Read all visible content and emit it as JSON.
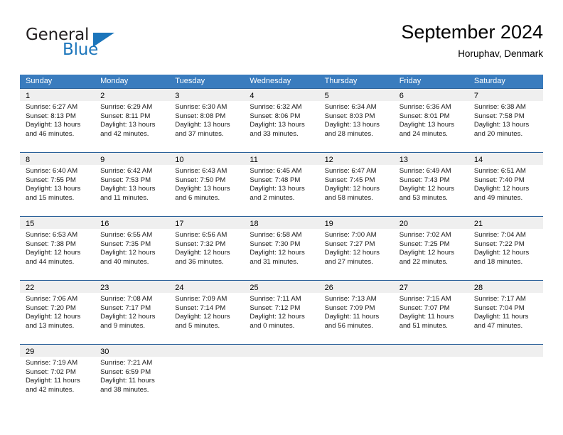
{
  "brand": {
    "name_part1": "General",
    "name_part2": "Blue",
    "logo_icon": "triangle-logo-icon"
  },
  "header": {
    "title": "September 2024",
    "location": "Horuphav, Denmark"
  },
  "colors": {
    "header_blue": "#3a7cbe",
    "rule_blue": "#2a6099",
    "band_gray": "#efefef",
    "brand_blue": "#1b75bb"
  },
  "weekdays": [
    "Sunday",
    "Monday",
    "Tuesday",
    "Wednesday",
    "Thursday",
    "Friday",
    "Saturday"
  ],
  "weeks": [
    [
      {
        "day": "1",
        "sunrise": "Sunrise: 6:27 AM",
        "sunset": "Sunset: 8:13 PM",
        "daylight1": "Daylight: 13 hours",
        "daylight2": "and 46 minutes."
      },
      {
        "day": "2",
        "sunrise": "Sunrise: 6:29 AM",
        "sunset": "Sunset: 8:11 PM",
        "daylight1": "Daylight: 13 hours",
        "daylight2": "and 42 minutes."
      },
      {
        "day": "3",
        "sunrise": "Sunrise: 6:30 AM",
        "sunset": "Sunset: 8:08 PM",
        "daylight1": "Daylight: 13 hours",
        "daylight2": "and 37 minutes."
      },
      {
        "day": "4",
        "sunrise": "Sunrise: 6:32 AM",
        "sunset": "Sunset: 8:06 PM",
        "daylight1": "Daylight: 13 hours",
        "daylight2": "and 33 minutes."
      },
      {
        "day": "5",
        "sunrise": "Sunrise: 6:34 AM",
        "sunset": "Sunset: 8:03 PM",
        "daylight1": "Daylight: 13 hours",
        "daylight2": "and 28 minutes."
      },
      {
        "day": "6",
        "sunrise": "Sunrise: 6:36 AM",
        "sunset": "Sunset: 8:01 PM",
        "daylight1": "Daylight: 13 hours",
        "daylight2": "and 24 minutes."
      },
      {
        "day": "7",
        "sunrise": "Sunrise: 6:38 AM",
        "sunset": "Sunset: 7:58 PM",
        "daylight1": "Daylight: 13 hours",
        "daylight2": "and 20 minutes."
      }
    ],
    [
      {
        "day": "8",
        "sunrise": "Sunrise: 6:40 AM",
        "sunset": "Sunset: 7:55 PM",
        "daylight1": "Daylight: 13 hours",
        "daylight2": "and 15 minutes."
      },
      {
        "day": "9",
        "sunrise": "Sunrise: 6:42 AM",
        "sunset": "Sunset: 7:53 PM",
        "daylight1": "Daylight: 13 hours",
        "daylight2": "and 11 minutes."
      },
      {
        "day": "10",
        "sunrise": "Sunrise: 6:43 AM",
        "sunset": "Sunset: 7:50 PM",
        "daylight1": "Daylight: 13 hours",
        "daylight2": "and 6 minutes."
      },
      {
        "day": "11",
        "sunrise": "Sunrise: 6:45 AM",
        "sunset": "Sunset: 7:48 PM",
        "daylight1": "Daylight: 13 hours",
        "daylight2": "and 2 minutes."
      },
      {
        "day": "12",
        "sunrise": "Sunrise: 6:47 AM",
        "sunset": "Sunset: 7:45 PM",
        "daylight1": "Daylight: 12 hours",
        "daylight2": "and 58 minutes."
      },
      {
        "day": "13",
        "sunrise": "Sunrise: 6:49 AM",
        "sunset": "Sunset: 7:43 PM",
        "daylight1": "Daylight: 12 hours",
        "daylight2": "and 53 minutes."
      },
      {
        "day": "14",
        "sunrise": "Sunrise: 6:51 AM",
        "sunset": "Sunset: 7:40 PM",
        "daylight1": "Daylight: 12 hours",
        "daylight2": "and 49 minutes."
      }
    ],
    [
      {
        "day": "15",
        "sunrise": "Sunrise: 6:53 AM",
        "sunset": "Sunset: 7:38 PM",
        "daylight1": "Daylight: 12 hours",
        "daylight2": "and 44 minutes."
      },
      {
        "day": "16",
        "sunrise": "Sunrise: 6:55 AM",
        "sunset": "Sunset: 7:35 PM",
        "daylight1": "Daylight: 12 hours",
        "daylight2": "and 40 minutes."
      },
      {
        "day": "17",
        "sunrise": "Sunrise: 6:56 AM",
        "sunset": "Sunset: 7:32 PM",
        "daylight1": "Daylight: 12 hours",
        "daylight2": "and 36 minutes."
      },
      {
        "day": "18",
        "sunrise": "Sunrise: 6:58 AM",
        "sunset": "Sunset: 7:30 PM",
        "daylight1": "Daylight: 12 hours",
        "daylight2": "and 31 minutes."
      },
      {
        "day": "19",
        "sunrise": "Sunrise: 7:00 AM",
        "sunset": "Sunset: 7:27 PM",
        "daylight1": "Daylight: 12 hours",
        "daylight2": "and 27 minutes."
      },
      {
        "day": "20",
        "sunrise": "Sunrise: 7:02 AM",
        "sunset": "Sunset: 7:25 PM",
        "daylight1": "Daylight: 12 hours",
        "daylight2": "and 22 minutes."
      },
      {
        "day": "21",
        "sunrise": "Sunrise: 7:04 AM",
        "sunset": "Sunset: 7:22 PM",
        "daylight1": "Daylight: 12 hours",
        "daylight2": "and 18 minutes."
      }
    ],
    [
      {
        "day": "22",
        "sunrise": "Sunrise: 7:06 AM",
        "sunset": "Sunset: 7:20 PM",
        "daylight1": "Daylight: 12 hours",
        "daylight2": "and 13 minutes."
      },
      {
        "day": "23",
        "sunrise": "Sunrise: 7:08 AM",
        "sunset": "Sunset: 7:17 PM",
        "daylight1": "Daylight: 12 hours",
        "daylight2": "and 9 minutes."
      },
      {
        "day": "24",
        "sunrise": "Sunrise: 7:09 AM",
        "sunset": "Sunset: 7:14 PM",
        "daylight1": "Daylight: 12 hours",
        "daylight2": "and 5 minutes."
      },
      {
        "day": "25",
        "sunrise": "Sunrise: 7:11 AM",
        "sunset": "Sunset: 7:12 PM",
        "daylight1": "Daylight: 12 hours",
        "daylight2": "and 0 minutes."
      },
      {
        "day": "26",
        "sunrise": "Sunrise: 7:13 AM",
        "sunset": "Sunset: 7:09 PM",
        "daylight1": "Daylight: 11 hours",
        "daylight2": "and 56 minutes."
      },
      {
        "day": "27",
        "sunrise": "Sunrise: 7:15 AM",
        "sunset": "Sunset: 7:07 PM",
        "daylight1": "Daylight: 11 hours",
        "daylight2": "and 51 minutes."
      },
      {
        "day": "28",
        "sunrise": "Sunrise: 7:17 AM",
        "sunset": "Sunset: 7:04 PM",
        "daylight1": "Daylight: 11 hours",
        "daylight2": "and 47 minutes."
      }
    ],
    [
      {
        "day": "29",
        "sunrise": "Sunrise: 7:19 AM",
        "sunset": "Sunset: 7:02 PM",
        "daylight1": "Daylight: 11 hours",
        "daylight2": "and 42 minutes."
      },
      {
        "day": "30",
        "sunrise": "Sunrise: 7:21 AM",
        "sunset": "Sunset: 6:59 PM",
        "daylight1": "Daylight: 11 hours",
        "daylight2": "and 38 minutes."
      },
      {
        "day": "",
        "sunrise": "",
        "sunset": "",
        "daylight1": "",
        "daylight2": ""
      },
      {
        "day": "",
        "sunrise": "",
        "sunset": "",
        "daylight1": "",
        "daylight2": ""
      },
      {
        "day": "",
        "sunrise": "",
        "sunset": "",
        "daylight1": "",
        "daylight2": ""
      },
      {
        "day": "",
        "sunrise": "",
        "sunset": "",
        "daylight1": "",
        "daylight2": ""
      },
      {
        "day": "",
        "sunrise": "",
        "sunset": "",
        "daylight1": "",
        "daylight2": ""
      }
    ]
  ]
}
